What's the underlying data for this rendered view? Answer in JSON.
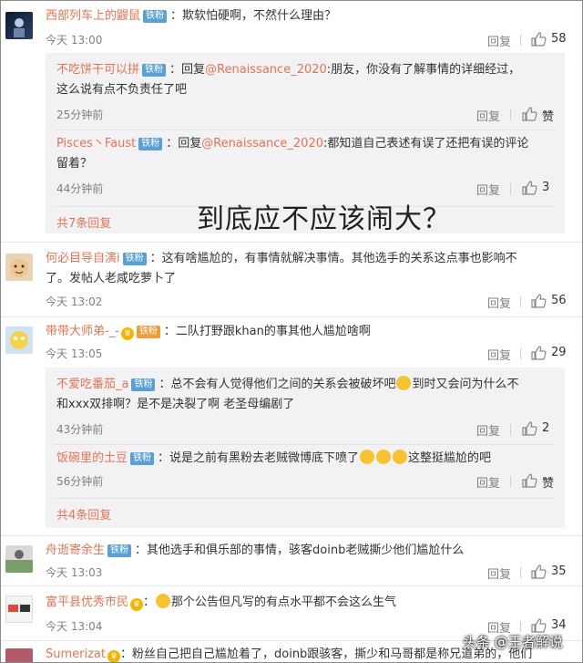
{
  "c1": {
    "name": "西部列车上的鼹鼠",
    "badge": "铁粉",
    "text": "：欺软怕硬啊，不然什么理由？",
    "time": "今天 13:00",
    "reply": "回复",
    "likes": "58"
  },
  "r1": {
    "name": "不吃饼干可以拼",
    "badge": "铁粉",
    "text1": "：回复",
    "at": "@Renaissance_2020",
    "text2": ":朋友，你没有了解事情的详细经过，",
    "line2": "这么说有点不负责任了吧",
    "time": "25分钟前",
    "reply": "回复",
    "likes": "赞"
  },
  "r2": {
    "name": "Pisces丶Faust",
    "badge": "铁粉",
    "text1": "：回复",
    "at": "@Renaissance_2020",
    "text2": ":都知道自己表述有误了还把有误的评论",
    "line2": "留着？",
    "time": "44分钟前",
    "reply": "回复",
    "likes": "3"
  },
  "more1": "共7条回复",
  "overlay": "到底应不应该闹大？",
  "c2": {
    "name": "何必目导自演i",
    "badge": "铁粉",
    "text": "：这有啥尴尬的，有事情就解决事情。其他选手的关系这点事也影响不",
    "line2": "了。发帖人老咸吃萝卜了",
    "time": "今天 13:02",
    "reply": "回复",
    "likes": "56"
  },
  "c3": {
    "name": "带带大师弟-_-",
    "crown": "铁粉",
    "text": "：二队打野跟khan的事其他人尴尬啥啊",
    "time": "今天 13:05",
    "reply": "回复",
    "likes": "29"
  },
  "r3": {
    "name": "不爱吃番茄_a",
    "badge": "铁粉",
    "text1": "：总不会有人觉得他们之间的关系会被破坏吧",
    "text2": "到时又会问为什么不",
    "line2": "和xxx双排啊？是不是决裂了啊 老圣母编剧了",
    "time": "43分钟前",
    "reply": "回复",
    "likes": "2"
  },
  "r4": {
    "name": "饭碗里的土豆",
    "badge": "铁粉",
    "text1": "：说是之前有黑粉去老贼微博底下喷了",
    "text2": "这整挺尴尬的吧",
    "time": "56分钟前",
    "reply": "回复",
    "likes": "赞"
  },
  "more2": "共4条回复",
  "c4": {
    "name": "舟逝寄余生",
    "badge": "铁粉",
    "text": "：其他选手和俱乐部的事情，骇客doinb老贼撕少他们尴尬什么",
    "time": "今天 13:03",
    "reply": "回复",
    "likes": "35"
  },
  "c5": {
    "name": "富平县优秀市民",
    "text": "那个公告但凡写的有点水平都不会这么生气",
    "time": "今天 13:04",
    "reply": "回复",
    "likes": "34"
  },
  "c6": {
    "name": "Sumerizat",
    "text": "：粉丝自己把自己尴尬着了，doinb跟骇客，撕少和马哥都是称兄道弟的，他们"
  },
  "watermark": "头条 @王者解说",
  "colors": {
    "name": "#eb7350",
    "badge": "#5aa0d6",
    "replyBg": "#f2f2f5",
    "meta": "#808080"
  }
}
